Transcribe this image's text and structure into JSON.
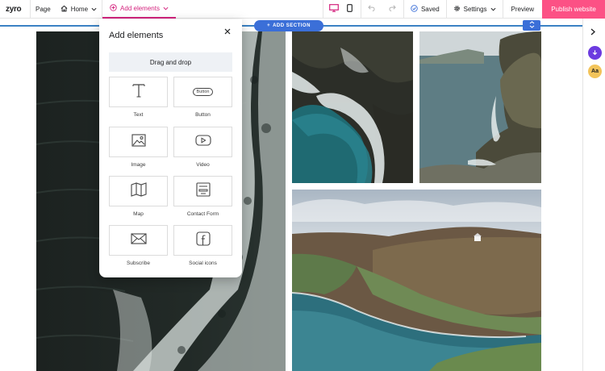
{
  "app": {
    "logo": "zyro"
  },
  "topbar": {
    "page_label": "Page",
    "home_label": "Home",
    "add_elements_label": "Add elements",
    "saved_label": "Saved",
    "settings_label": "Settings",
    "preview_label": "Preview",
    "publish_label": "Publish website"
  },
  "canvas": {
    "add_section_label": "ADD SECTION",
    "photos": [
      "ocean-waves-aerial",
      "waves-on-rocks-aerial",
      "sea-cliffs",
      "coastal-hills-and-bay"
    ]
  },
  "panel": {
    "title": "Add elements",
    "drag_drop_label": "Drag and drop",
    "tiles": [
      {
        "label": "Text",
        "icon": "text-icon"
      },
      {
        "label": "Button",
        "icon": "button-icon",
        "inner": "Button"
      },
      {
        "label": "Image",
        "icon": "image-icon"
      },
      {
        "label": "Video",
        "icon": "video-icon"
      },
      {
        "label": "Map",
        "icon": "map-icon"
      },
      {
        "label": "Contact Form",
        "icon": "form-icon"
      },
      {
        "label": "Subscribe",
        "icon": "envelope-icon"
      },
      {
        "label": "Social icons",
        "icon": "facebook-icon"
      }
    ]
  },
  "rail": {
    "typography_label": "Aa"
  },
  "colors": {
    "accent": "#d4237e",
    "publish": "#fc5185",
    "primary_blue": "#3b6fd8",
    "rail_purple": "#6c3be0",
    "rail_yellow": "#f3c45b"
  }
}
